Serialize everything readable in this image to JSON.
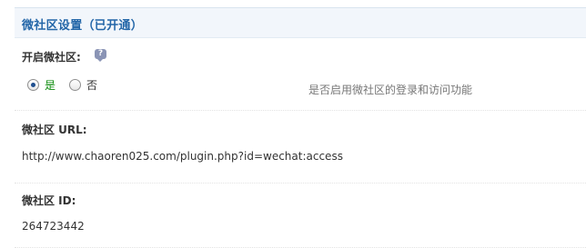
{
  "header": {
    "title": "微社区设置（已开通）"
  },
  "enable_section": {
    "label": "开启微社区:",
    "help_icon": "question-bubble-icon",
    "options": [
      {
        "label": "是",
        "selected": true
      },
      {
        "label": "否",
        "selected": false
      }
    ],
    "description": "是否启用微社区的登录和访问功能"
  },
  "url_section": {
    "label": "微社区 URL:",
    "value": "http://www.chaoren025.com/plugin.php?id=wechat:access"
  },
  "id_section": {
    "label": "微社区 ID:",
    "value": "264723442"
  },
  "colors": {
    "header_bg": "#f2f6fb",
    "header_text": "#2366a8",
    "yes_label": "#0a8a0a",
    "description_text": "#777777"
  }
}
